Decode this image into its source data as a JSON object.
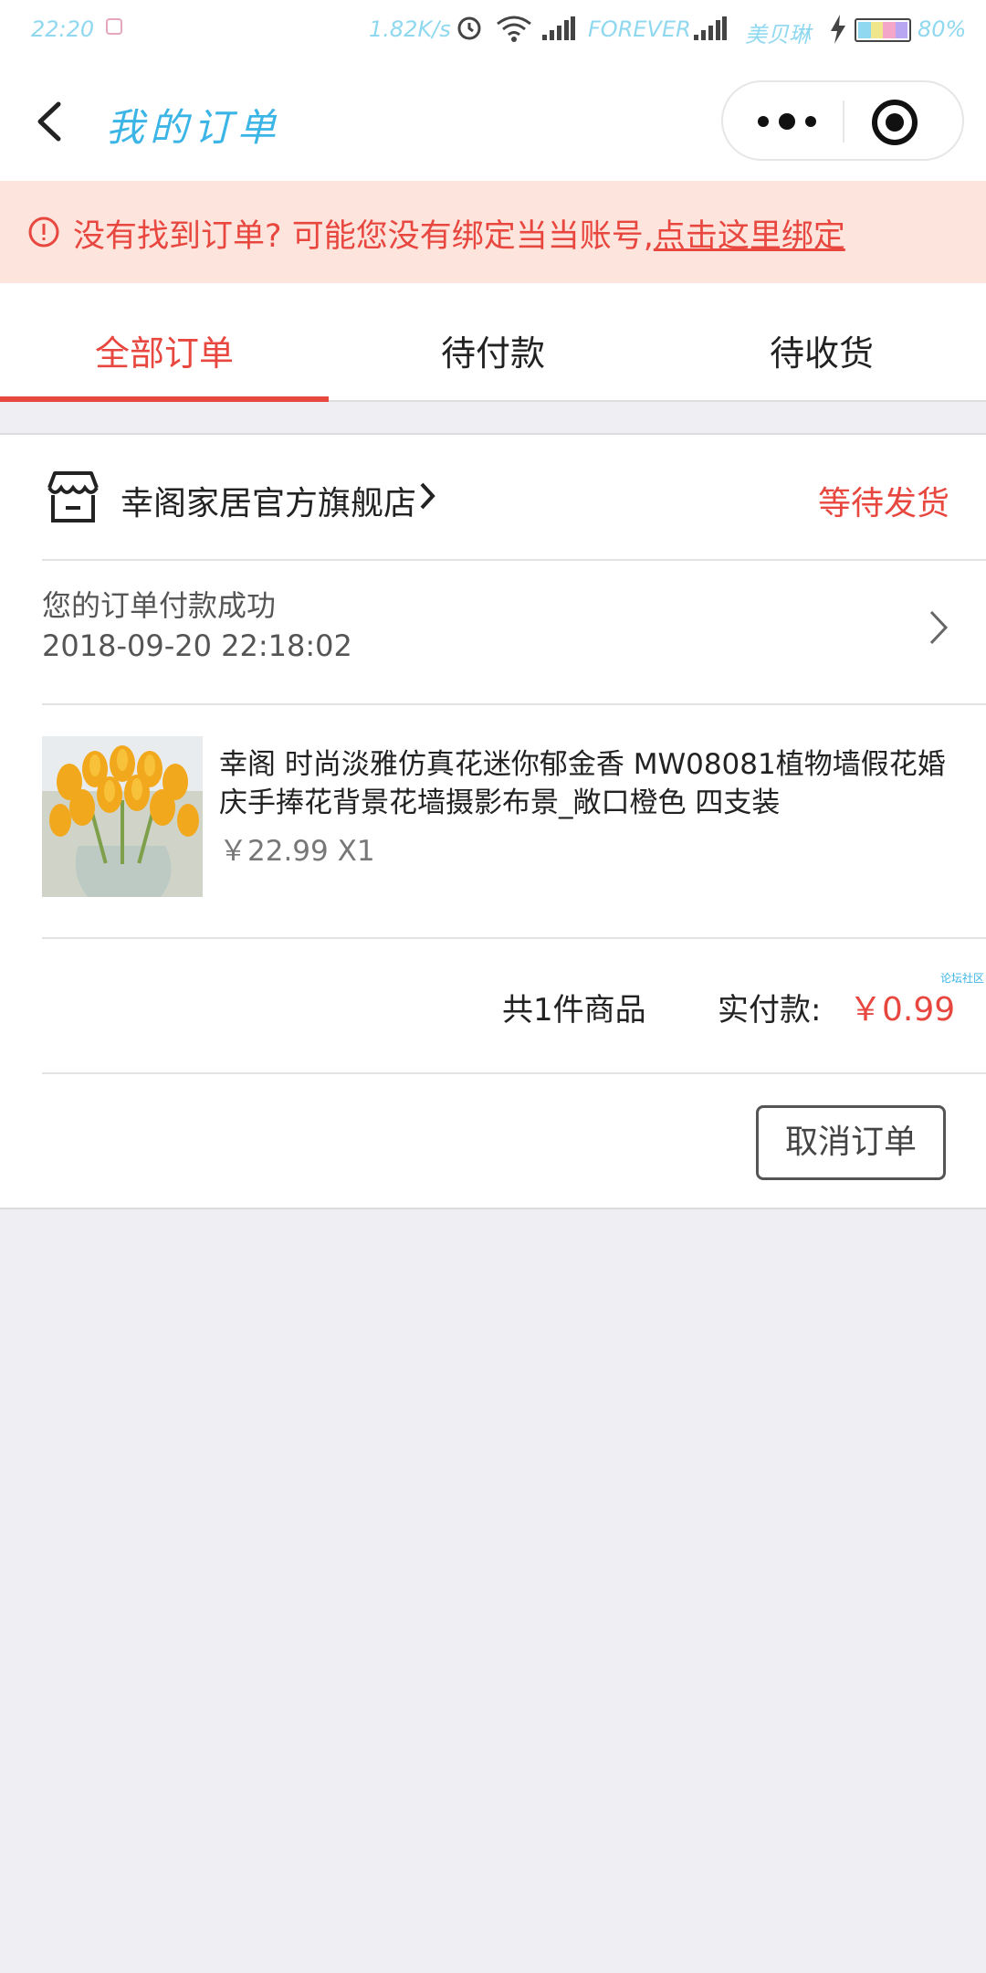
{
  "status_bar": {
    "time": "22:20",
    "net_speed": "1.82K/s",
    "carrier1": "FOREVER",
    "carrier2": "美贝琳",
    "battery": "80%"
  },
  "navbar": {
    "title": "我的订单",
    "icons": [
      "back-arrow-icon",
      "more-dots-icon",
      "target-close-icon"
    ]
  },
  "banner": {
    "text": "没有找到订单? 可能您没有绑定当当账号,",
    "link": "点击这里绑定",
    "color": "#e8473f",
    "background": "#fde4dd"
  },
  "tabs": [
    {
      "label": "全部订单",
      "active": true
    },
    {
      "label": "待付款",
      "active": false
    },
    {
      "label": "待收货",
      "active": false
    }
  ],
  "order": {
    "shop_name": "幸阁家居官方旗舰店",
    "status": "等待发货",
    "message": "您的订单付款成功",
    "time": "2018-09-20 22:18:02",
    "product": {
      "name": "幸阁 时尚淡雅仿真花迷你郁金香 MW08081植物墙假花婚庆手捧花背景花墙摄影布景_敞口橙色 四支装",
      "price": "￥22.99 X1"
    },
    "total_count": "共1件商品",
    "total_label": "实付款:",
    "total_amount": "￥0.99",
    "watermark": "论坛社区",
    "cancel_label": "取消订单"
  },
  "colors": {
    "accent": "#e8473f",
    "title_blue": "#3bb4e6",
    "page_bg": "#eeeef3"
  }
}
